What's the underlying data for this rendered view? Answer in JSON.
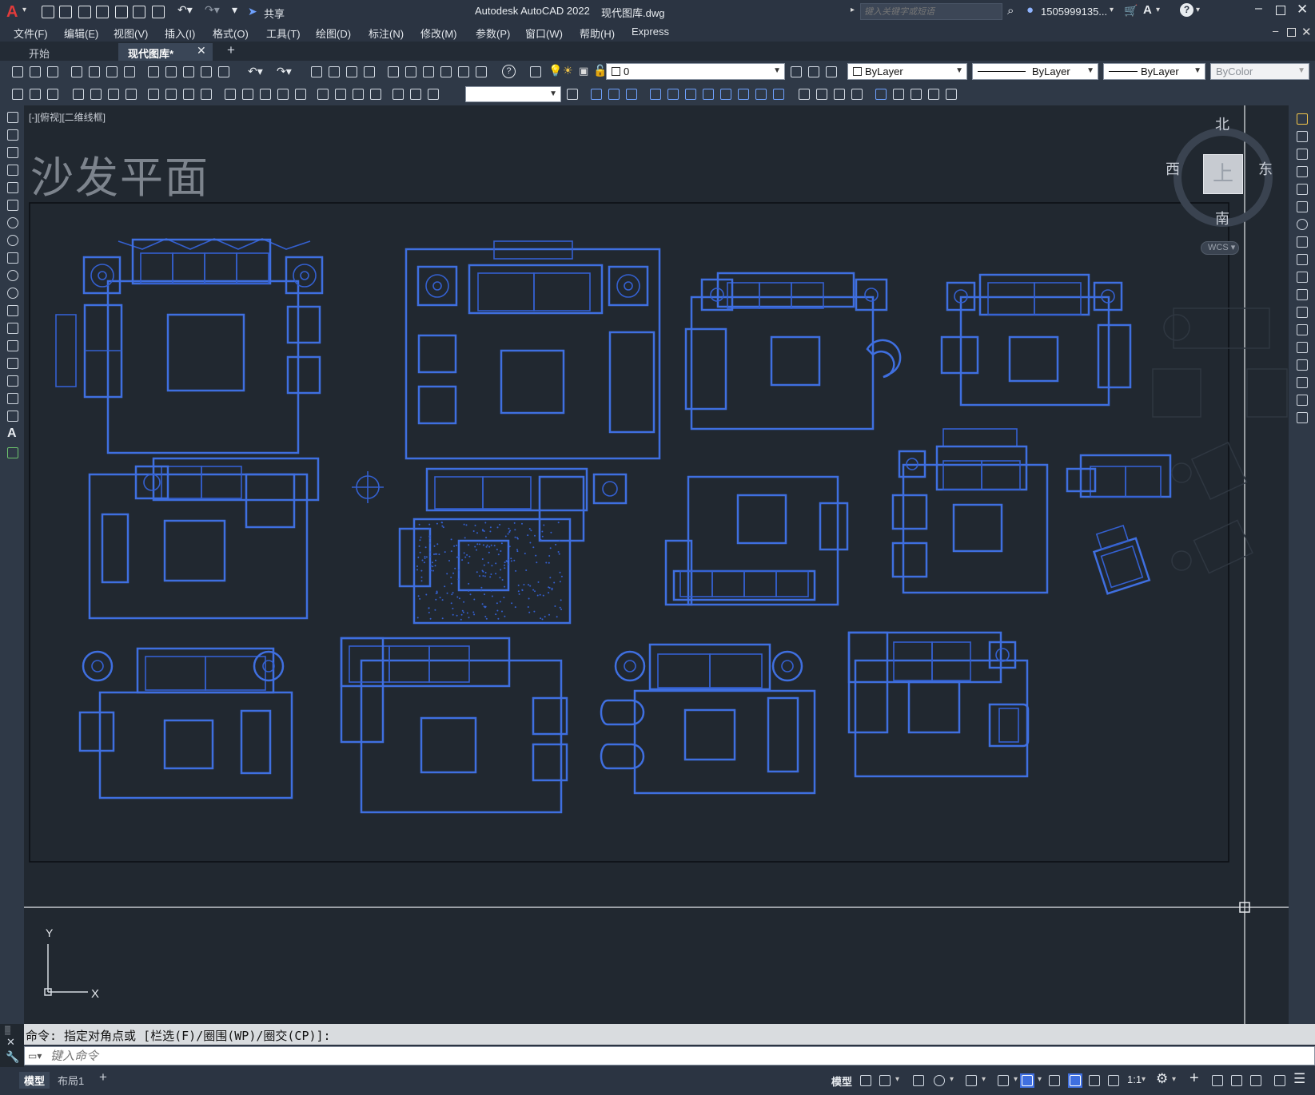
{
  "app": {
    "title": "Autodesk AutoCAD 2022",
    "filename": "现代图库.dwg",
    "share_label": "共享",
    "search_placeholder": "键入关键字或短语",
    "user": "1505999135...",
    "logo_letter": "A"
  },
  "menu": [
    "文件(F)",
    "编辑(E)",
    "视图(V)",
    "插入(I)",
    "格式(O)",
    "工具(T)",
    "绘图(D)",
    "标注(N)",
    "修改(M)",
    "参数(P)",
    "窗口(W)",
    "帮助(H)",
    "Express"
  ],
  "tabs": [
    {
      "label": "开始",
      "active": false
    },
    {
      "label": "现代图库*",
      "active": true
    }
  ],
  "toolbar": {
    "layer_value": "0",
    "color_value": "ByLayer",
    "linetype_value": "ByLayer",
    "lineweight_value": "ByLayer",
    "plotstyle_value": "ByColor"
  },
  "viewport": {
    "label": "[-][俯视][二维线框]",
    "drawing_title": "沙发平面"
  },
  "viewcube": {
    "north": "北",
    "south": "南",
    "east": "东",
    "west": "西",
    "face": "上",
    "wcs": "WCS"
  },
  "ucs": {
    "x": "X",
    "y": "Y"
  },
  "command": {
    "history": "命令: 指定对角点或 [栏选(F)/圈围(WP)/圈交(CP)]:",
    "placeholder": "键入命令"
  },
  "layout_tabs": [
    {
      "label": "模型",
      "active": true
    },
    {
      "label": "布局1",
      "active": false
    }
  ],
  "status": {
    "model_label": "模型",
    "scale": "1:1"
  },
  "colors": {
    "accent": "#3f6fe0",
    "background": "#212830",
    "chrome": "#2f3947"
  },
  "icons": [
    "new-icon",
    "open-icon",
    "save-icon",
    "saveas-icon",
    "plot-icon",
    "undo-icon",
    "redo-icon",
    "share-icon",
    "search-icon",
    "user-icon",
    "cart-icon",
    "help-icon",
    "minimize-icon",
    "maximize-icon",
    "close-icon"
  ]
}
